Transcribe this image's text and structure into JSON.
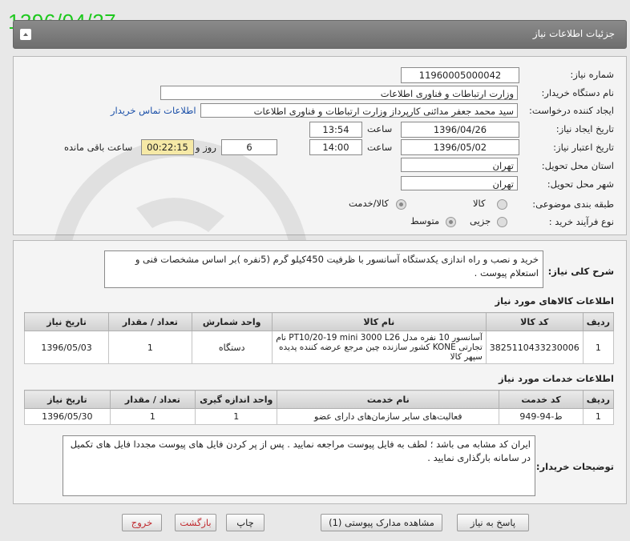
{
  "date_stamp": "1396/04/27",
  "header": {
    "title": "جزئیات اطلاعات نیاز"
  },
  "form": {
    "need_number_label": "شماره نیاز:",
    "need_number": "11960005000042",
    "buyer_org_label": "نام دستگاه خریدار:",
    "buyer_org": "وزارت ارتباطات و فناوری اطلاعات",
    "requester_label": "ایجاد کننده درخواست:",
    "requester": "سید محمد جعفر مدائنی کارپرداز وزارت ارتباطات و فناوری اطلاعات",
    "contact_link": "اطلاعات تماس خریدار",
    "created_label": "تاریخ ایجاد نیاز:",
    "created_date": "1396/04/26",
    "time_label": "ساعت",
    "created_time": "13:54",
    "validity_label": "تاریخ اعتبار نیاز:",
    "validity_date": "1396/05/02",
    "validity_time": "14:00",
    "days": "6",
    "days_label": "روز و",
    "remaining_time": "00:22:15",
    "remaining_label": "ساعت باقی مانده",
    "province_label": "استان محل تحویل:",
    "province": "تهران",
    "city_label": "شهر محل تحویل:",
    "city": "تهران",
    "category_label": "طبقه بندی موضوعی:",
    "category_options": [
      "کالا",
      "کالا/خدمت"
    ],
    "process_label": "نوع فرآیند خرید :",
    "process_options": [
      "جزیی",
      "متوسط"
    ]
  },
  "description": {
    "label": "شرح کلی نیاز:",
    "text": "خرید و نصب و راه اندازی  یکدستگاه آسانسور با ظرفیت 450کیلو گرم (5نفره )بر اساس مشخصات فنی و استعلام پیوست ."
  },
  "goods": {
    "title": "اطلاعات کالاهای مورد نیاز",
    "headers": [
      "ردیف",
      "کد کالا",
      "نام کالا",
      "واحد شمارش",
      "تعداد / مقدار",
      "تاریخ نیاز"
    ],
    "rows": [
      [
        "1",
        "3825110433230006",
        "آسانسور 10 نفره مدل PT10/20-19 mini 3000 L26 نام تجارتی KONE کشور سازنده چین مرجع عرضه کننده پدیده سپهر کالا",
        "دستگاه",
        "1",
        "1396/05/03"
      ]
    ]
  },
  "services": {
    "title": "اطلاعات خدمات مورد نیاز",
    "headers": [
      "ردیف",
      "کد خدمت",
      "نام خدمت",
      "واحد اندازه گیری",
      "تعداد / مقدار",
      "تاریخ نیاز"
    ],
    "rows": [
      [
        "1",
        "ط-94-949",
        "فعالیت‌های سایر سازمان‌های دارای عضو",
        "1",
        "1",
        "1396/05/30"
      ]
    ]
  },
  "buyer_notes": {
    "label": "توضیحات خریدار:",
    "text": "ایران کد مشابه می باشد ؛ لطف به فایل پیوست مراجعه نمایید . پس از پر  کردن فایل های پیوست مجددا فایل های تکمیل در سامانه بارگذاری نمایید ."
  },
  "buttons": {
    "reply": "پاسخ به نیاز",
    "attachments": "مشاهده مدارک پیوستی (1)",
    "print": "چاپ",
    "back": "بازگشت",
    "exit": "خروج"
  }
}
